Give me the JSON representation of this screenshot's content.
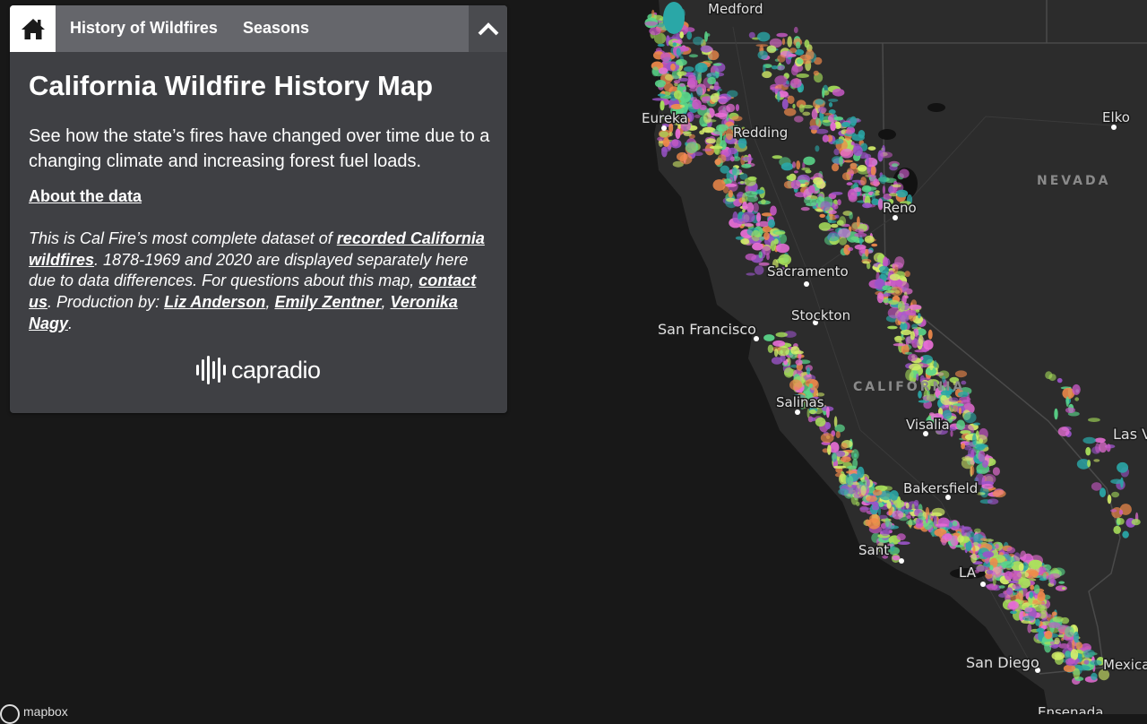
{
  "tabs": {
    "home_icon": "home-icon",
    "history": "History of Wildfires",
    "seasons": "Seasons",
    "collapse_icon": "chevron-up-icon"
  },
  "panel": {
    "title": "California Wildfire History Map",
    "subtitle": "See how the state’s fires have changed over time due to a changing climate and increasing forest fuel loads.",
    "about_link": "About the data",
    "info": {
      "t1": "This is Cal Fire’s most complete dataset of ",
      "link_recorded": "recorded California wildfires",
      "t2": ". 1878-1969 and 2020 are displayed separately here due to data differences. For questions about this map, ",
      "link_contact": "contact us",
      "t3": ". Production by: ",
      "link_liz": "Liz Anderson",
      "sep1": ", ",
      "link_emily": "Emily Zentner",
      "sep2": ", ",
      "link_veronika": "Veronika Nagy",
      "t4": "."
    },
    "logo_text": "capradio"
  },
  "map": {
    "colors": {
      "background": "#181818",
      "land": "#2c2c2c",
      "water_body": "#121212",
      "boundary": "#444444",
      "fire_palette": [
        "#c759c5",
        "#e86fd6",
        "#a8e05b",
        "#d6f06a",
        "#2aa7a7",
        "#f08a4b",
        "#5ad68a",
        "#9b54c9"
      ]
    },
    "labels": {
      "medford": "Medford",
      "eureka": "Eureka",
      "redding": "Redding",
      "elko": "Elko",
      "nevada": "NEVADA",
      "reno": "Reno",
      "sacramento": "Sacramento",
      "stockton": "Stockton",
      "san_francisco": "San Francisco",
      "california": "CALIFORNIA",
      "salinas": "Salinas",
      "visalia": "Visalia",
      "las_vegas": "Las V",
      "bakersfield": "Bakersfield",
      "santa_barbara": "Sant",
      "los_angeles": "LA",
      "san_diego": "San Diego",
      "mexicali": "Mexica",
      "ensenada": "Ensenada"
    },
    "attribution": "mapbox"
  }
}
